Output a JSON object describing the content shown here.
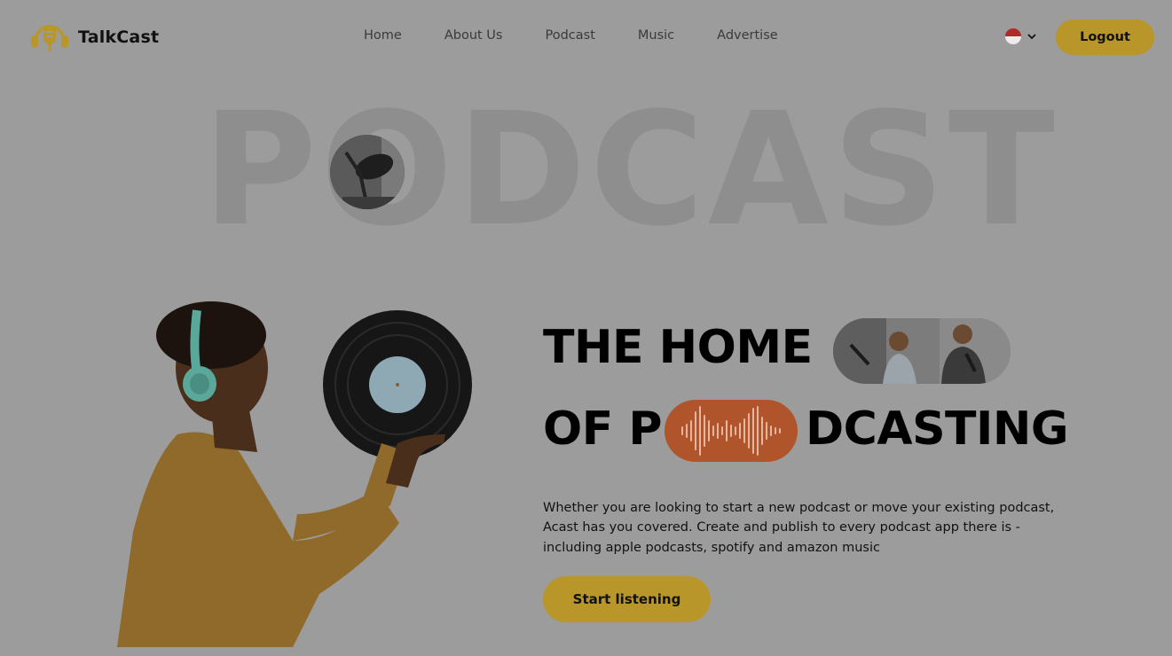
{
  "header": {
    "brand": "TalkCast",
    "nav": [
      "Home",
      "About Us",
      "Podcast",
      "Music",
      "Advertise"
    ],
    "logout_label": "Logout"
  },
  "hero": {
    "bg_word": "PODCAST",
    "headline_line1": "THE HOME",
    "headline_line2_start": "OF P",
    "headline_line2_end": "DCASTING",
    "description": "Whether you are looking to start a new podcast or move your existing podcast, Acast has you covered. Create and publish to every podcast app there is - including apple podcasts, spotify and amazon music",
    "cta_label": "Start listening"
  },
  "colors": {
    "accent": "#b8962a",
    "wave_pill": "#b0542b",
    "background": "#9c9c9c"
  },
  "icons": [
    "microphone-logo-icon",
    "language-flag-icon",
    "chevron-down-icon",
    "sound-wave-icon"
  ]
}
